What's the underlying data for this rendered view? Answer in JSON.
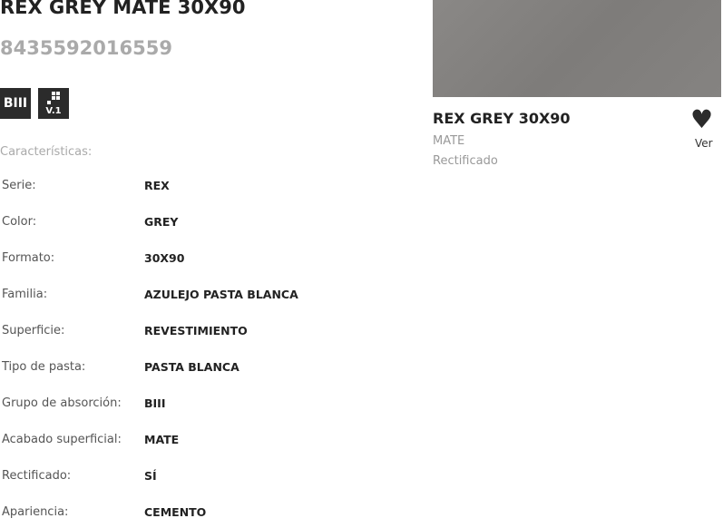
{
  "product": {
    "title": "REX GREY MATE 30X90",
    "ean": "8435592016559",
    "badges": [
      "BIII",
      "V.1"
    ]
  },
  "features_label": "Características:",
  "features": [
    {
      "label": "Serie:",
      "value": "REX"
    },
    {
      "label": "Color:",
      "value": "GREY"
    },
    {
      "label": "Formato:",
      "value": "30X90"
    },
    {
      "label": "Familia:",
      "value": "AZULEJO PASTA BLANCA"
    },
    {
      "label": "Superficie:",
      "value": "REVESTIMIENTO"
    },
    {
      "label": "Tipo de pasta:",
      "value": "PASTA BLANCA"
    },
    {
      "label": "Grupo de absorción:",
      "value": "BIII"
    },
    {
      "label": "Acabado superficial:",
      "value": "MATE"
    },
    {
      "label": "Rectificado:",
      "value": "SÍ"
    },
    {
      "label": "Apariencia:",
      "value": "CEMENTO"
    }
  ],
  "card": {
    "title": "REX GREY 30X90",
    "finish": "MATE",
    "edge": "Rectificado",
    "view_label": "Ver",
    "heart_icon": "heart-icon"
  }
}
